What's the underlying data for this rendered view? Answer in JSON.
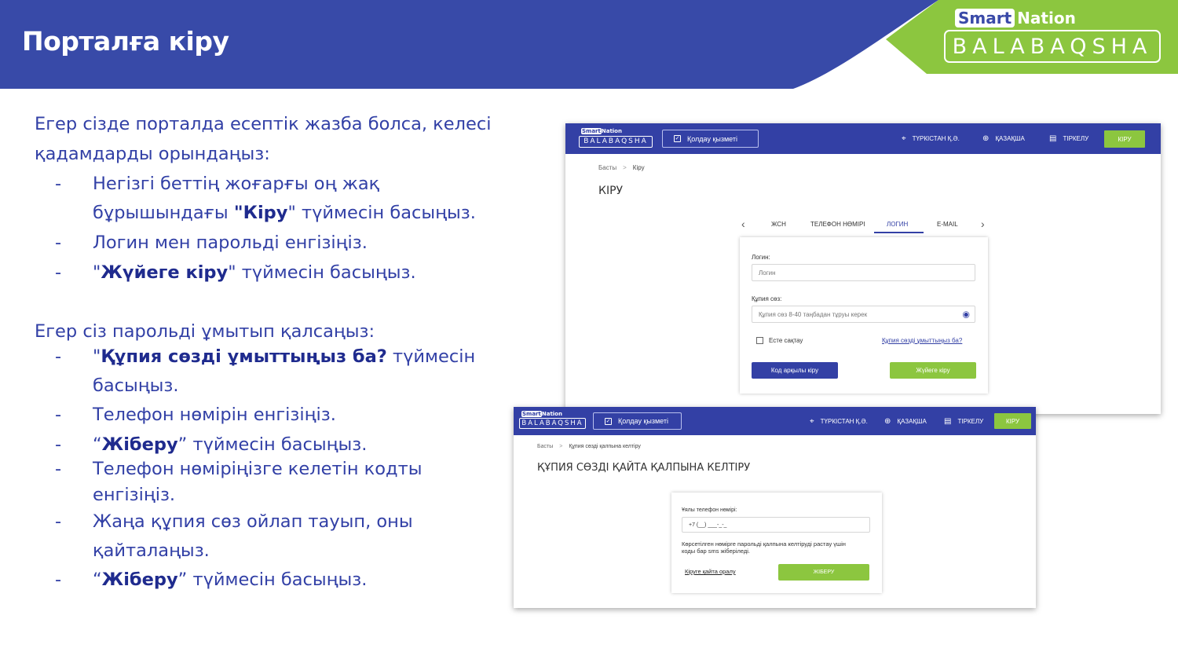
{
  "slide": {
    "title": "Порталға кіру",
    "colors": {
      "header_blue": "#384aa8",
      "brand_green": "#8cc63f",
      "text_blue": "#3240a6"
    }
  },
  "brand": {
    "smart": "Smart",
    "nation": "Nation",
    "name": "BALABAQSHA"
  },
  "instructions": {
    "intro": [
      "Егер сізде порталда есептік жазба болса, келесі",
      "қадамдарды орындаңыз:"
    ],
    "steps1": [
      {
        "dash": "-",
        "line1": "Негізгі беттің жоғарғы оң жақ",
        "pre": "бұрышындағы ",
        "bold": "\"Кіру",
        "post": "\" түймесін басыңыз."
      },
      {
        "dash": "-",
        "text": "Логин мен парольді енгізіңіз."
      },
      {
        "dash": "-",
        "pre": "\"",
        "bold": "Жүйеге кіру",
        "post": "\" түймесін басыңыз."
      }
    ],
    "forgot_intro": "Егер сіз парольді ұмытып қалсаңыз:",
    "steps2": [
      {
        "dash": "-",
        "pre": "\"",
        "bold": "Құпия сөзді ұмыттыңыз ба?",
        "post": " түймесін",
        "line2": "басыңыз."
      },
      {
        "dash": "-",
        "text": "Телефон нөмірін енгізіңіз."
      },
      {
        "dash": "-",
        "pre": " “",
        "bold": "Жіберу",
        "post": "” түймесін басыңыз."
      },
      {
        "dash": "-",
        "text": " Телефон нөміріңізге келетін кодты",
        "line2": "енгізіңіз."
      },
      {
        "dash": "-",
        "text": "Жаңа құпия сөз ойлап тауып, оны",
        "line2": "қайталаңыз."
      },
      {
        "dash": "-",
        "pre": "“",
        "bold": "Жіберу",
        "post": "” түймесін басыңыз."
      }
    ]
  },
  "screen_login": {
    "nav": {
      "logo_smart": "Smart",
      "logo_nation": "Nation",
      "logo_text": "BALABAQSHA",
      "support": "Қолдау қызметі",
      "location": "ТҮРКІСТАН Қ.Ә.",
      "language": "ҚАЗАҚША",
      "register": "ТІРКЕЛУ",
      "login": "КІРУ"
    },
    "breadcrumb": {
      "home": "Басты",
      "sep": ">",
      "current": "Кіру"
    },
    "title": "КІРУ",
    "tabs": [
      "ЖСН",
      "ТЕЛЕФОН НӨМІРІ",
      "ЛОГИН",
      "E-MAIL"
    ],
    "active_tab": "ЛОГИН",
    "arrows": {
      "left": "‹",
      "right": "›"
    },
    "form": {
      "login_label": "Логин:",
      "login_placeholder": "Логин",
      "password_label": "Құпия сөз:",
      "password_placeholder": "Құпия сөз 8-40 таңбадан тұруы керек",
      "remember": "Есте сақтау",
      "forgot": "Құпия сөзді ұмыттыңыз ба?",
      "code_login": "Код арқылы кіру",
      "submit": "Жүйеге кіру"
    }
  },
  "screen_reset": {
    "nav": {
      "logo_smart": "Smart",
      "logo_nation": "Nation",
      "logo_text": "BALABAQSHA",
      "support": "Қолдау қызметі",
      "location": "ТҮРКІСТАН Қ.Ә.",
      "language": "ҚАЗАҚША",
      "register": "ТІРКЕЛУ",
      "login": "КІРУ"
    },
    "breadcrumb": {
      "home": "Басты",
      "sep": ">",
      "current": "Құпия сөзді қалпына келтіру"
    },
    "title": "ҚҰПИЯ СӨЗДІ ҚАЙТА ҚАЛПЫНА КЕЛТІРУ",
    "form": {
      "phone_label": "Ұялы телефон нөмірі:",
      "phone_value": "+7 (__) ___-_-_",
      "note_line1": "Көрсетілген нөмірге парольді қалпына келтіруді растау үшін",
      "note_line2": "коды бар sms жіберіледі.",
      "back": "Кіруге қайта оралу",
      "submit": "ЖІБЕРУ"
    }
  }
}
